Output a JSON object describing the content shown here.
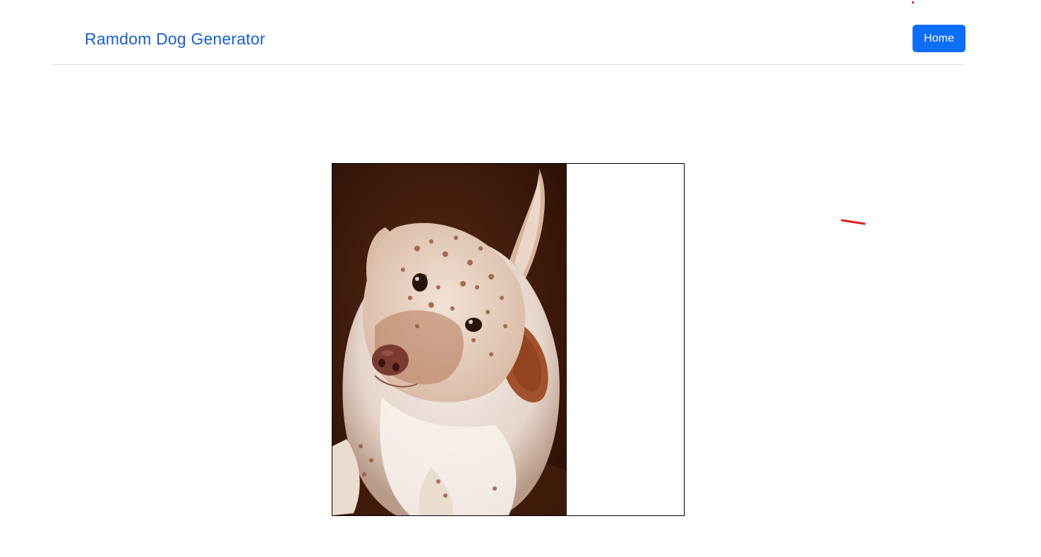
{
  "navbar": {
    "brand_label": "Ramdom Dog Generator",
    "home_label": "Home"
  },
  "dog_image": {
    "alt": "Random dog"
  },
  "colors": {
    "brand_text": "#1a5fd0",
    "home_button_bg": "#0d6efd",
    "annotation_mark": "#e02020"
  },
  "icons": {
    "annotation": "red-stroke-mark"
  }
}
